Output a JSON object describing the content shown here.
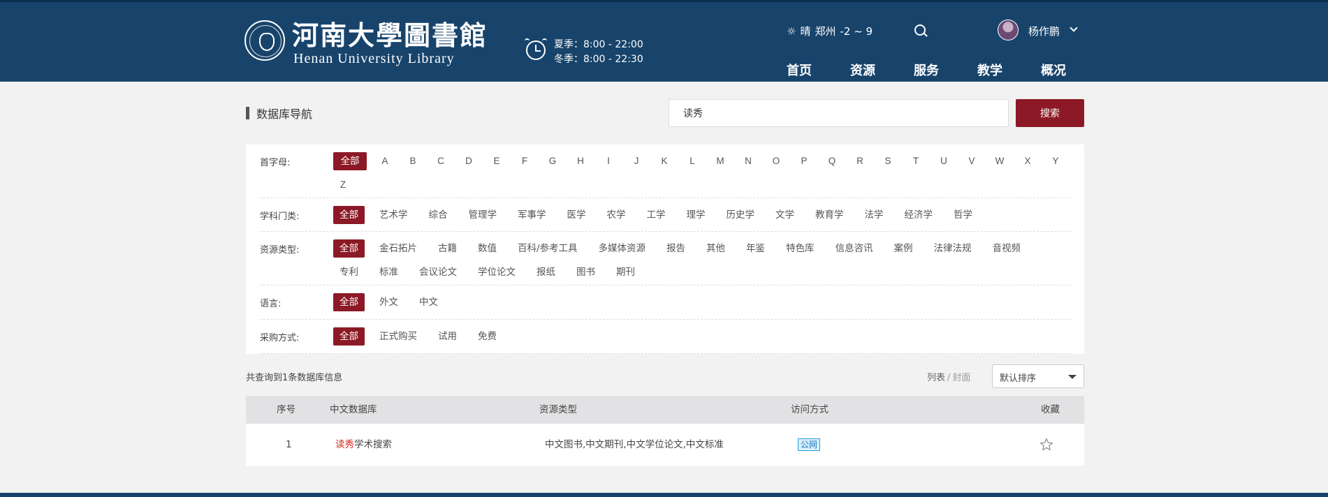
{
  "header": {
    "logo_cn": "河南大學圖書館",
    "logo_en": "Henan University Library",
    "hours": [
      "夏季：8:00 - 22:00",
      "冬季：8:00 - 22:30"
    ],
    "weather": {
      "condition": "晴",
      "city": "郑州",
      "temp": "-2 ~ 9"
    },
    "user": "杨作鹏",
    "nav": [
      "首页",
      "资源",
      "服务",
      "教学",
      "概况"
    ]
  },
  "page": {
    "title": "数据库导航",
    "search_value": "读秀",
    "search_button": "搜索"
  },
  "filters": {
    "letters": {
      "label": "首字母:",
      "options": [
        "全部",
        "A",
        "B",
        "C",
        "D",
        "E",
        "F",
        "G",
        "H",
        "I",
        "J",
        "K",
        "L",
        "M",
        "N",
        "O",
        "P",
        "Q",
        "R",
        "S",
        "T",
        "U",
        "V",
        "W",
        "X",
        "Y",
        "Z"
      ]
    },
    "subjects": {
      "label": "学科门类:",
      "options": [
        "全部",
        "艺术学",
        "综合",
        "管理学",
        "军事学",
        "医学",
        "农学",
        "工学",
        "理学",
        "历史学",
        "文学",
        "教育学",
        "法学",
        "经济学",
        "哲学"
      ]
    },
    "resource_types": {
      "label": "资源类型:",
      "options": [
        "全部",
        "金石拓片",
        "古籍",
        "数值",
        "百科/参考工具",
        "多媒体资源",
        "报告",
        "其他",
        "年鉴",
        "特色库",
        "信息咨讯",
        "案例",
        "法律法规",
        "音视频",
        "专利",
        "标准",
        "会议论文",
        "学位论文",
        "报纸",
        "图书",
        "期刊"
      ]
    },
    "language": {
      "label": "语言:",
      "options": [
        "全部",
        "外文",
        "中文"
      ]
    },
    "purchase": {
      "label": "采购方式:",
      "options": [
        "全部",
        "正式购买",
        "试用",
        "免费"
      ]
    }
  },
  "results": {
    "count_text": "共查询到1条数据库信息",
    "view_list": "列表",
    "view_sep": "/",
    "view_cover": "封面",
    "sort": "默认排序",
    "headers": [
      "序号",
      "中文数据库",
      "资源类型",
      "访问方式",
      "收藏"
    ],
    "rows": [
      {
        "no": "1",
        "name_hl": "读秀",
        "name_rest": "学术搜索",
        "types": "中文图书,中文期刊,中文学位论文,中文标准",
        "access": "公网"
      }
    ]
  },
  "colors": {
    "header": "#18446b",
    "accent": "#8c1a26",
    "highlight": "#e0261f"
  }
}
